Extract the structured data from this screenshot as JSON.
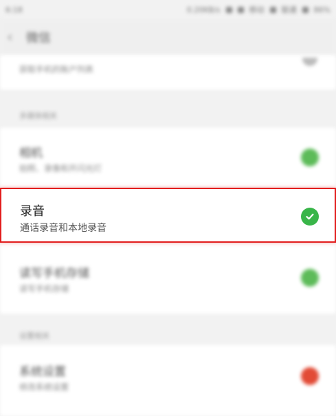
{
  "status_bar": {
    "time": "6:18",
    "speed": "0.20KB/s",
    "carrier1": "移动",
    "carrier2": "联通",
    "battery": "86%"
  },
  "header": {
    "title": "微信"
  },
  "top_item": {
    "subtitle": "获取手机的账户列表"
  },
  "sections": [
    {
      "header": "多媒体相关",
      "items": [
        {
          "label": "相机",
          "subtitle": "拍照、录像和开闪光灯",
          "state": "allowed"
        },
        {
          "label": "录音",
          "subtitle": "通话录音和本地录音",
          "state": "allowed",
          "highlighted": true
        },
        {
          "label": "读写手机存储",
          "subtitle": "读写手机存储",
          "state": "allowed"
        }
      ]
    },
    {
      "header": "设置相关",
      "items": [
        {
          "label": "系统设置",
          "subtitle": "修改系统设置",
          "state": "denied"
        }
      ]
    }
  ],
  "colors": {
    "allowed": "#39b549",
    "denied": "#e24b36",
    "highlight_border": "#e21d1d"
  }
}
